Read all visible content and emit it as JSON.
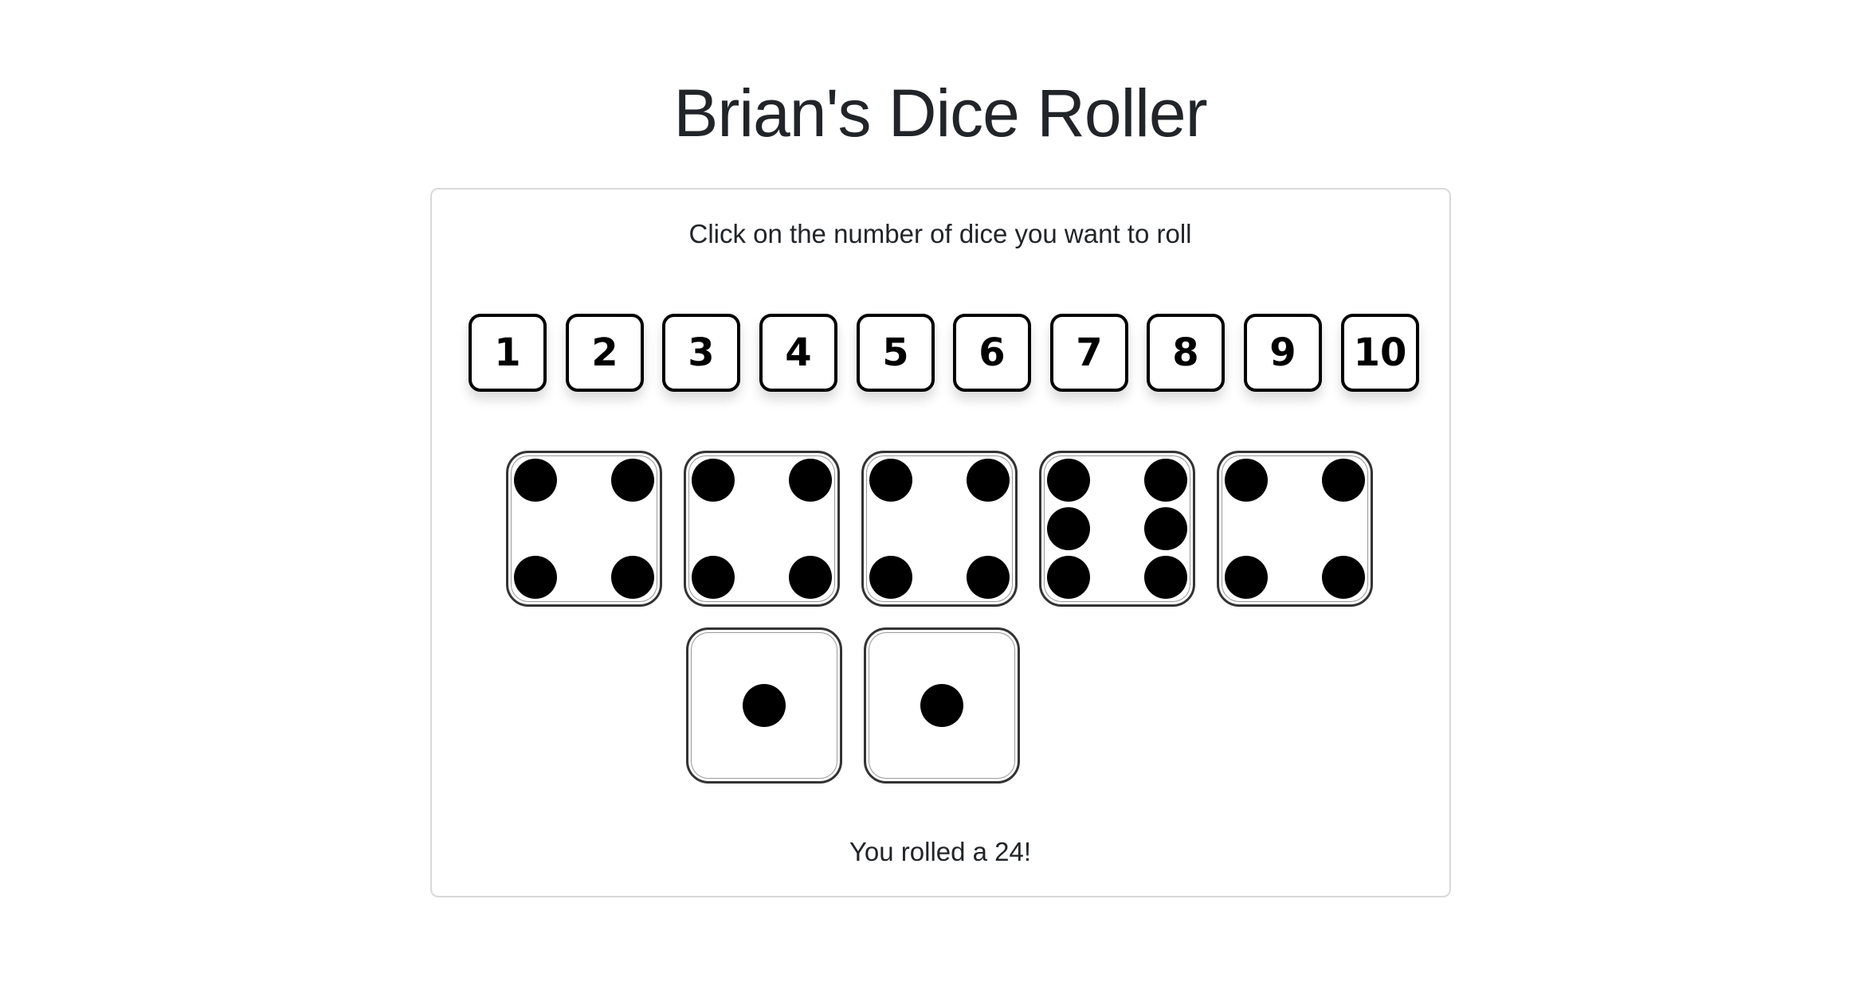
{
  "page": {
    "title": "Brian's Dice Roller"
  },
  "card": {
    "instruction": "Click on the number of dice you want to roll",
    "count_buttons": [
      {
        "label": "1"
      },
      {
        "label": "2"
      },
      {
        "label": "3"
      },
      {
        "label": "4"
      },
      {
        "label": "5"
      },
      {
        "label": "6"
      },
      {
        "label": "7"
      },
      {
        "label": "8"
      },
      {
        "label": "9"
      },
      {
        "label": "10"
      }
    ],
    "dice": [
      {
        "face": 4
      },
      {
        "face": 4
      },
      {
        "face": 4
      },
      {
        "face": 6
      },
      {
        "face": 4
      },
      {
        "face": 1
      },
      {
        "face": 1
      }
    ],
    "result_text": "You rolled a 24!"
  }
}
